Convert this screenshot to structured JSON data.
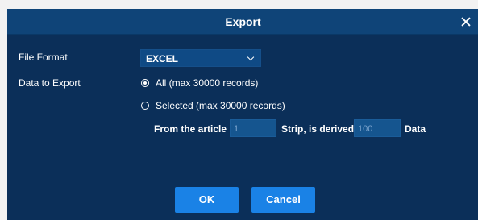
{
  "dialog": {
    "title": "Export",
    "close_icon": "close-icon"
  },
  "form": {
    "file_format_label": "File Format",
    "file_format_value": "EXCEL",
    "data_to_export_label": "Data to Export",
    "option_all": "All (max 30000 records)",
    "option_selected": "Selected (max 30000 records)",
    "from_article_label": "From the article",
    "from_article_value": "1",
    "strip_label": "Strip, is derived",
    "strip_value": "100",
    "data_label": "Data"
  },
  "buttons": {
    "ok": "OK",
    "cancel": "Cancel"
  },
  "colors": {
    "dialog_bg": "#0b2f59",
    "titlebar_bg": "#0f4478",
    "button_bg": "#1a82e6"
  }
}
